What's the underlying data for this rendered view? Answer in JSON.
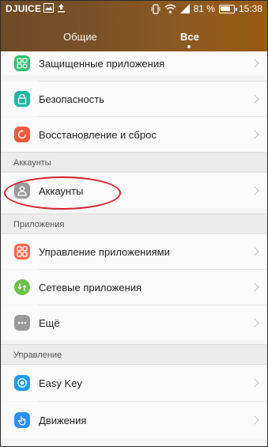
{
  "status_bar": {
    "carrier": "DJUICE",
    "battery_percent": "81 %",
    "battery_level": 0.81,
    "time": "15:38"
  },
  "tabs": [
    {
      "label": "Общие",
      "active": false
    },
    {
      "label": "Все",
      "active": true
    }
  ],
  "list": {
    "protected_apps": "Защищенные приложения",
    "security": "Безопасность",
    "backup_reset": "Восстановление и сброс",
    "section_accounts": "Аккаунты",
    "accounts": "Аккаунты",
    "section_apps": "Приложения",
    "app_management": "Управление приложениями",
    "network_apps": "Сетевые приложения",
    "more": "Ещё",
    "section_control": "Управление",
    "easy_key": "Easy Key",
    "motions": "Движения"
  },
  "colors": {
    "header_gradient_start": "#6e4a26",
    "header_gradient_end": "#9a5a14",
    "protected_icon": "#2fbf71",
    "security_icon": "#1fb5a8",
    "backup_icon": "#f05a3e",
    "accounts_icon": "#9a9a9a",
    "app_mgmt_icon": "#f26b4a",
    "network_icon": "#6cc04a",
    "more_icon": "#9a9a9a",
    "easy_key_icon": "#1e9ee8",
    "motions_icon": "#2e8ff0",
    "highlight": "#d2232a"
  }
}
